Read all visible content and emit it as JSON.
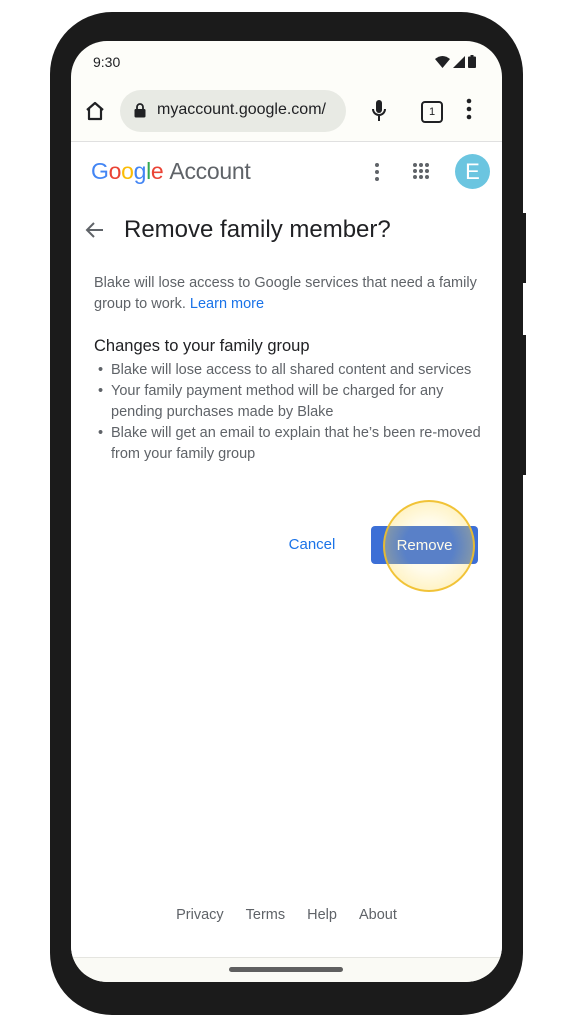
{
  "status_bar": {
    "time": "9:30",
    "icons": [
      "wifi-icon",
      "signal-icon",
      "battery-icon"
    ]
  },
  "browser": {
    "url": "myaccount.google.com/",
    "tab_count": "1",
    "icons": [
      "home-icon",
      "lock-icon",
      "mic-icon",
      "tabs-icon",
      "more-vert-icon"
    ]
  },
  "header": {
    "logo_letters": [
      "G",
      "o",
      "o",
      "g",
      "l",
      "e"
    ],
    "product": "Account",
    "avatar_initial": "E",
    "avatar_color": "#6bc5e0"
  },
  "page": {
    "title": "Remove family member?",
    "intro": "Blake will lose access to Google services that need a family group to work.",
    "learn_more": "Learn more",
    "section_title": "Changes to your family group",
    "bullets": [
      "Blake will lose access to all shared content and services",
      "Your family payment method will be charged for any pending purchases made by Blake",
      "Blake will get an email to explain that he’s been re-moved from your family group"
    ],
    "cancel_label": "Cancel",
    "remove_label": "Remove",
    "accent_color": "#1a73e8"
  },
  "footer": {
    "links": [
      "Privacy",
      "Terms",
      "Help",
      "About"
    ]
  }
}
